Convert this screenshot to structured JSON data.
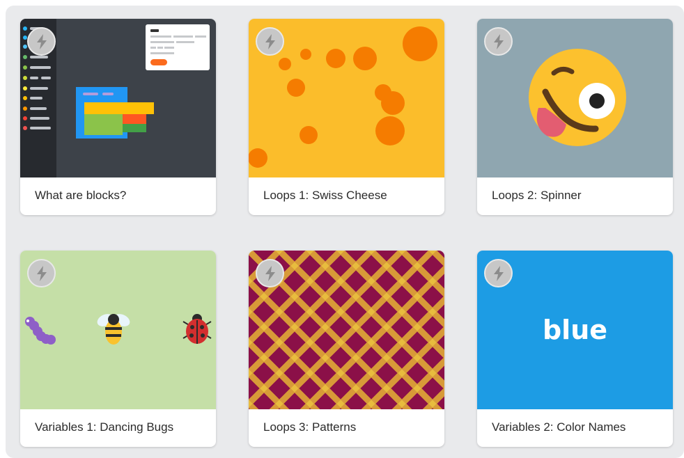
{
  "cards": [
    {
      "title": "What are blocks?",
      "badge_icon": "lightning-icon"
    },
    {
      "title": "Loops 1: Swiss Cheese",
      "badge_icon": "lightning-icon"
    },
    {
      "title": "Loops 2: Spinner",
      "badge_icon": "lightning-icon"
    },
    {
      "title": "Variables 1: Dancing Bugs",
      "badge_icon": "lightning-icon"
    },
    {
      "title": "Loops 3: Patterns",
      "badge_icon": "lightning-icon"
    },
    {
      "title": "Variables 2: Color Names",
      "badge_icon": "lightning-icon",
      "thumb_word": "blue"
    }
  ],
  "colors": {
    "panel_bg": "#e9eaec",
    "blocks_bg": "#3d4249",
    "cheese_bg": "#fbbd2b",
    "cheese_hole": "#f57c00",
    "spinner_bg": "#8fa6b0",
    "bugs_bg": "#c5dfa7",
    "pattern_base": "#8b1048",
    "pattern_stripe": "#d89a38",
    "colornames_bg": "#1d9ce4"
  }
}
